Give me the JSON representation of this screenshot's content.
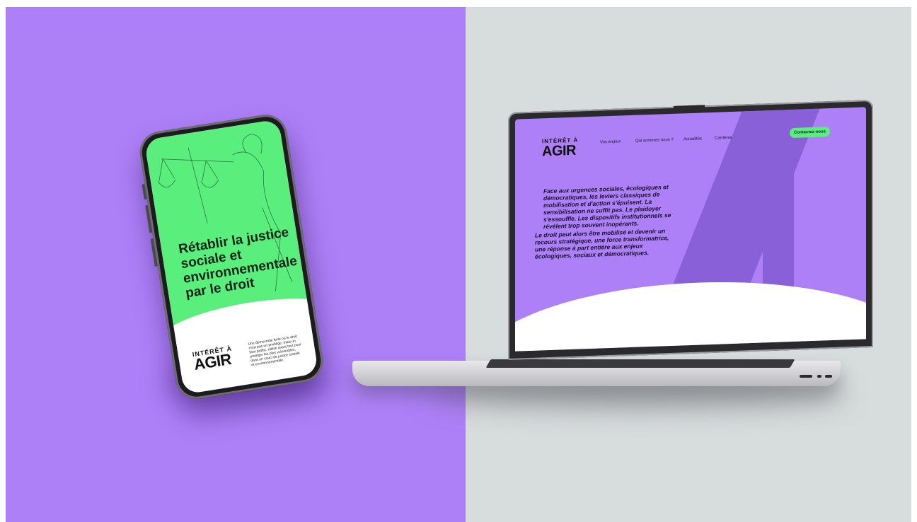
{
  "phone": {
    "title": "Rétablir la justice sociale et environnementale par le droit",
    "logo_top": "INTÉRÊT À",
    "logo_main": "AGIR",
    "blurb": "Une démocratie forte où le droit n'est pas un privilège, mais un bien public, utilisé avant tout pour protéger les plus vulnérables, dans un souci de justice sociale et environnementale."
  },
  "laptop": {
    "logo_top": "INTÉRÊT À",
    "logo_main": "AGIR",
    "nav": [
      "Vos enjeux",
      "Qui sommes-nous ?",
      "Actualités",
      "Carrières"
    ],
    "cta": "Contactez-nous",
    "paragraph1": "Face aux urgences sociales, écologiques et démocratiques, les leviers classiques de mobilisation et d'action s'épuisent. La sensibilisation ne suffit pas. Le plaidoyer s'essouffle. Les dispositifs institutionnels se révèlent trop souvent inopérants.",
    "paragraph2": "Le droit peut alors être mobilisé et devenir un recours stratégique, une force transformatrice, une réponse à part entière aux enjeux écologiques, sociaux et démocratiques."
  },
  "colors": {
    "purple": "#ae80f8",
    "grey": "#d7dcdc",
    "green": "#5aef7d"
  }
}
